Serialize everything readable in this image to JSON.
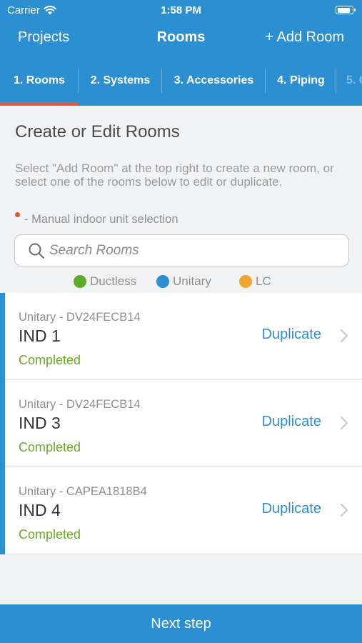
{
  "status_bar": {
    "carrier": "Carrier",
    "time": "1:58 PM",
    "battery_level": 0.9
  },
  "nav": {
    "left": "Projects",
    "title": "Rooms",
    "right": "+ Add Room"
  },
  "tabs": [
    {
      "label": "1.  Rooms",
      "active": true
    },
    {
      "label": "2. Systems",
      "active": false
    },
    {
      "label": "3. Accessories",
      "active": false
    },
    {
      "label": "4. Piping",
      "active": false
    },
    {
      "label": "5. C",
      "active": false
    }
  ],
  "heading": "Create or Edit Rooms",
  "instructions": "Select \"Add Room\" at the top right to create a new room, or select one of the rooms below to edit or duplicate.",
  "manual_note": "- Manual indoor unit selection",
  "search": {
    "placeholder": "Search Rooms",
    "value": ""
  },
  "legend": [
    {
      "label": "Ductless",
      "color": "#5ea82a"
    },
    {
      "label": "Unitary",
      "color": "#2b8fd2"
    },
    {
      "label": "LC",
      "color": "#f0a530"
    }
  ],
  "rooms": [
    {
      "model": "Unitary - DV24FECB14",
      "name": "IND 1",
      "status": "Completed",
      "action": "Duplicate"
    },
    {
      "model": "Unitary - DV24FECB14",
      "name": "IND 3",
      "status": "Completed",
      "action": "Duplicate"
    },
    {
      "model": "Unitary - CAPEA1818B4",
      "name": "IND 4",
      "status": "Completed",
      "action": "Duplicate"
    }
  ],
  "footer": {
    "label": "Next step"
  },
  "colors": {
    "primary": "#2b8fd2",
    "accent": "#e8553a",
    "completed": "#6aa82a"
  },
  "icons": {
    "wifi": "wifi-icon",
    "search": "search-icon",
    "chevron": "chevron-right-icon"
  }
}
